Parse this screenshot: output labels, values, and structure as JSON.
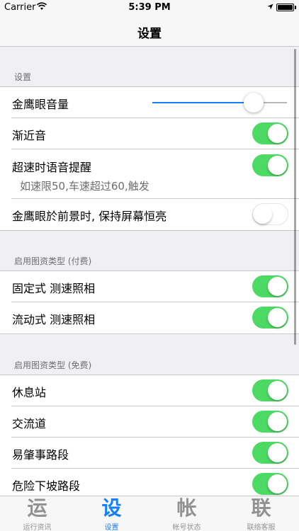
{
  "status_bar": {
    "carrier": "Carrier",
    "time": "5:39 PM"
  },
  "nav": {
    "title": "设置"
  },
  "sections": {
    "settings": {
      "header": "设置",
      "volume_label": "金鹰眼音量",
      "volume_level": 0.75,
      "approach_sound_label": "渐近音",
      "approach_sound_on": true,
      "speeding_alert_label": "超速时语音提醒",
      "speeding_alert_desc": "如速限50,车速超过60,触发",
      "speeding_alert_on": true,
      "screen_on_label": "金鹰眼於前景时, 保持屏幕恒亮",
      "screen_on_on": false
    },
    "paid": {
      "header": "启用图资类型 (付费)",
      "fixed_camera_label": "固定式 测速照相",
      "mobile_camera_label": "流动式 测速照相"
    },
    "free": {
      "header": "启用图资类型 (免费)",
      "rest_stop_label": "休息站",
      "interchange_label": "交流道",
      "accident_prone_label": "易肇事路段",
      "downhill_label": "危险下坡路段"
    }
  },
  "tabs": [
    {
      "glyph": "运",
      "label": "运行资讯"
    },
    {
      "glyph": "设",
      "label": "设置"
    },
    {
      "glyph": "帐",
      "label": "帐号状态"
    },
    {
      "glyph": "联",
      "label": "联络客服"
    }
  ],
  "colors": {
    "accent": "#147efb",
    "toggle_on": "#4cd964",
    "background": "#efeff4"
  }
}
